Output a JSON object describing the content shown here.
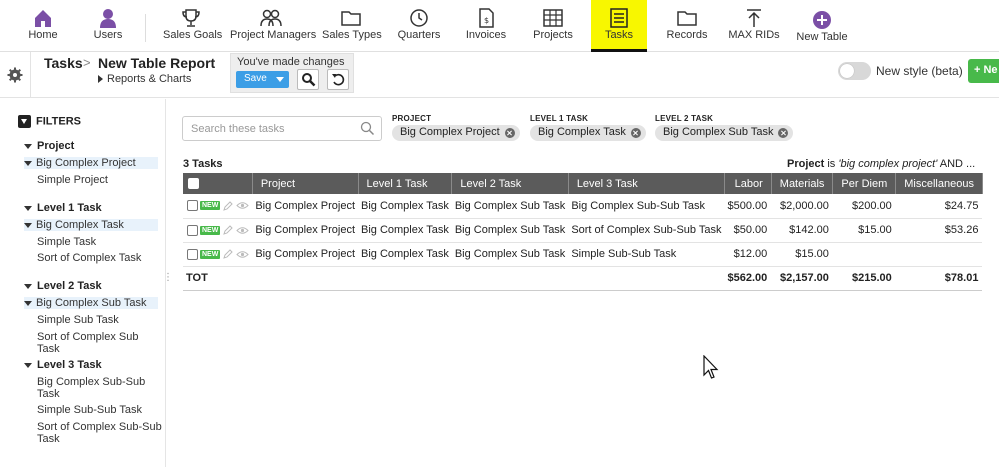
{
  "nav": {
    "items": [
      {
        "label": "Home",
        "icon": "home-icon"
      },
      {
        "label": "Users",
        "icon": "user-icon"
      },
      {
        "label": "Sales Goals",
        "icon": "trophy-icon"
      },
      {
        "label": "Project Managers",
        "icon": "managers-icon"
      },
      {
        "label": "Sales Types",
        "icon": "folder-icon"
      },
      {
        "label": "Quarters",
        "icon": "clock-icon"
      },
      {
        "label": "Invoices",
        "icon": "invoice-icon"
      },
      {
        "label": "Projects",
        "icon": "grid-icon"
      },
      {
        "label": "Tasks",
        "icon": "list-icon"
      },
      {
        "label": "Records",
        "icon": "folder-icon"
      },
      {
        "label": "MAX RIDs",
        "icon": "upload-icon"
      },
      {
        "label": "New Table",
        "icon": "plus-circle-icon"
      }
    ],
    "active": "Tasks",
    "accent": "#7b4fa6",
    "active_bg": "#f8f700"
  },
  "header": {
    "breadcrumb_root": "Tasks",
    "title": "New Table Report",
    "sub_link": "Reports & Charts",
    "changes_text": "You've made changes",
    "save_label": "Save",
    "toggle_label": "New style (beta)",
    "new_button_label": "+ Ne"
  },
  "sidebar": {
    "title": "FILTERS",
    "groups": [
      {
        "label": "Project",
        "items": [
          "Big Complex Project",
          "Simple Project"
        ],
        "selected": "Big Complex Project"
      },
      {
        "label": "Level 1 Task",
        "items": [
          "Big Complex Task",
          "Simple Task",
          "Sort of Complex Task"
        ],
        "selected": "Big Complex Task"
      },
      {
        "label": "Level 2 Task",
        "items": [
          "Big Complex Sub Task",
          "Simple Sub Task",
          "Sort of Complex Sub Task"
        ],
        "selected": "Big Complex Sub Task"
      },
      {
        "label": "Level 3 Task",
        "items": [
          "Big Complex Sub-Sub Task",
          "Simple Sub-Sub Task",
          "Sort of Complex Sub-Sub Task"
        ],
        "selected": null
      }
    ]
  },
  "search": {
    "placeholder": "Search these tasks"
  },
  "chips": [
    {
      "label": "PROJECT",
      "value": "Big Complex Project"
    },
    {
      "label": "LEVEL 1 TASK",
      "value": "Big Complex Task"
    },
    {
      "label": "LEVEL 2 TASK",
      "value": "Big Complex Sub Task"
    }
  ],
  "results": {
    "count": "3 Tasks",
    "summary_field": "Project",
    "summary_rest": " is ",
    "summary_value": "'big complex project'",
    "summary_tail": " AND ..."
  },
  "table": {
    "columns": [
      "Project",
      "Level 1 Task",
      "Level 2 Task",
      "Level 3 Task",
      "Labor",
      "Materials",
      "Per Diem",
      "Miscellaneous"
    ],
    "badge": "NEW",
    "rows": [
      [
        "Big Complex Project",
        "Big Complex Task",
        "Big Complex Sub Task",
        "Big Complex Sub-Sub Task",
        "$500.00",
        "$2,000.00",
        "$200.00",
        "$24.75"
      ],
      [
        "Big Complex Project",
        "Big Complex Task",
        "Big Complex Sub Task",
        "Sort of Complex Sub-Sub Task",
        "$50.00",
        "$142.00",
        "$15.00",
        "$53.26"
      ],
      [
        "Big Complex Project",
        "Big Complex Task",
        "Big Complex Sub Task",
        "Simple Sub-Sub Task",
        "$12.00",
        "$15.00",
        "",
        ""
      ]
    ],
    "total_label": "TOT",
    "totals": [
      "$562.00",
      "$2,157.00",
      "$215.00",
      "$78.01"
    ]
  }
}
